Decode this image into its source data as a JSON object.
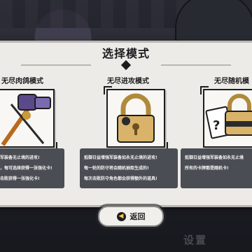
{
  "background": {
    "corner_text": "设置"
  },
  "modal": {
    "title": "选择模式",
    "cards": [
      {
        "title": "无尽肉鸽模式",
        "icon": "hammer-weapon-icon",
        "desc_lines": [
          "军装备无止境的进攻!",
          "，每可选择获得一张强化卡!",
          "击败获得一张强化卡!"
        ]
      },
      {
        "title": "无尽进攻模式",
        "icon": "gold-padlock-icon",
        "desc_lines": [
          "抵御日益增强军装备如永无止境的进攻!",
          "每一轮的防守将会随机抽取生成的!",
          "每次击败防守角色都会获得额外的道具!"
        ]
      },
      {
        "title": "无尽随机模",
        "icon": "random-cards-padlock-icon",
        "desc_lines": [
          "抵御日益增强军装备如永无止境",
          "所有的卡牌都是随机卡!"
        ]
      }
    ],
    "back_label": "返回"
  }
}
